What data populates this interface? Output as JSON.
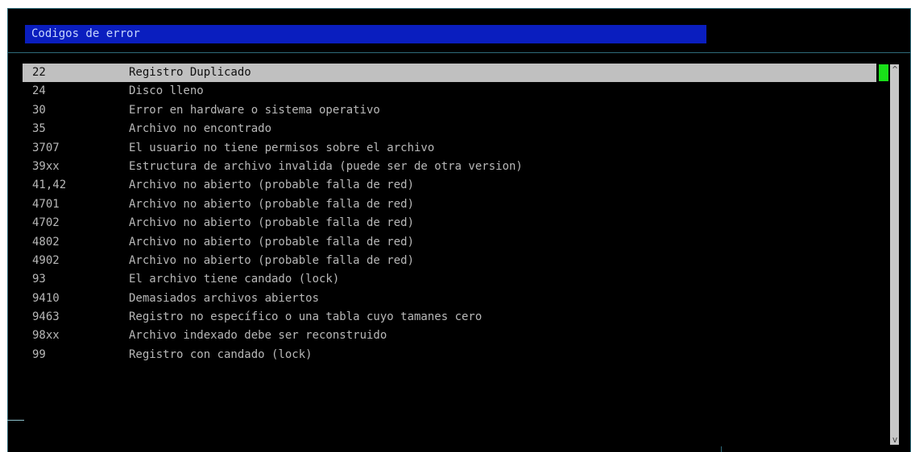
{
  "title": "Codigos de error",
  "rows": [
    {
      "code": "22",
      "desc": "Registro Duplicado"
    },
    {
      "code": "24",
      "desc": "Disco lleno"
    },
    {
      "code": "30",
      "desc": "Error en hardware o sistema operativo"
    },
    {
      "code": "35",
      "desc": "Archivo no encontrado"
    },
    {
      "code": "3707",
      "desc": "El usuario no tiene permisos sobre el archivo"
    },
    {
      "code": "39xx",
      "desc": "Estructura de archivo invalida (puede ser de otra version)"
    },
    {
      "code": "41,42",
      "desc": "Archivo no abierto (probable falla de red)"
    },
    {
      "code": "4701",
      "desc": "Archivo no abierto (probable falla de red)"
    },
    {
      "code": "4702",
      "desc": "Archivo no abierto (probable falla de red)"
    },
    {
      "code": "4802",
      "desc": "Archivo no abierto (probable falla de red)"
    },
    {
      "code": "4902",
      "desc": "Archivo no abierto (probable falla de red)"
    },
    {
      "code": "93",
      "desc": "El archivo tiene candado (lock)"
    },
    {
      "code": "9410",
      "desc": "Demasiados archivos abiertos"
    },
    {
      "code": "9463",
      "desc": "Registro no específico o una tabla cuyo tamanes cero"
    },
    {
      "code": "98xx",
      "desc": "Archivo indexado debe ser reconstruido"
    },
    {
      "code": "99",
      "desc": "Registro con candado (lock)"
    }
  ],
  "selected_index": 0,
  "scrollbar": {
    "up_glyph": "^",
    "down_glyph": "v"
  },
  "colors": {
    "background": "#000000",
    "title_bar": "#0a1ebf",
    "selection": "#c0c0c0",
    "scroll_thumb": "#19e019",
    "frame": "#2e6b7a"
  }
}
